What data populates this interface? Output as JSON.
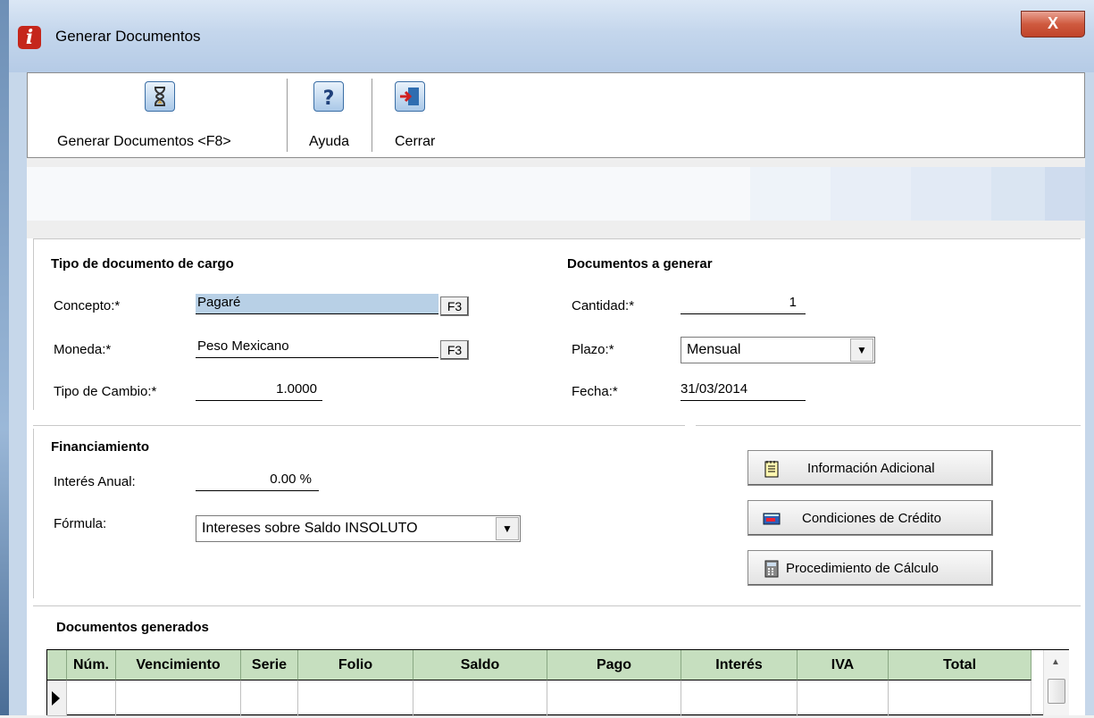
{
  "window": {
    "title": "Generar Documentos",
    "close_label": "X",
    "app_icon": "i"
  },
  "toolbar": {
    "generate_label": "Generar Documentos <F8>",
    "help_label": "Ayuda",
    "close_label": "Cerrar"
  },
  "cargo": {
    "title": "Tipo de documento de cargo",
    "concepto_label": "Concepto:*",
    "concepto_value": "Pagaré",
    "moneda_label": "Moneda:*",
    "moneda_value": "Peso Mexicano",
    "tipo_cambio_label": "Tipo de Cambio:*",
    "tipo_cambio_value": "1.0000",
    "f3": "F3"
  },
  "generar": {
    "title": "Documentos a generar",
    "cantidad_label": "Cantidad:*",
    "cantidad_value": "1",
    "plazo_label": "Plazo:*",
    "plazo_value": "Mensual",
    "fecha_label": "Fecha:*",
    "fecha_value": "31/03/2014"
  },
  "financiamiento": {
    "title": "Financiamiento",
    "interes_label": "Interés Anual:",
    "interes_value": "0.00 %",
    "formula_label": "Fórmula:",
    "formula_value": "Intereses sobre Saldo INSOLUTO"
  },
  "side_buttons": {
    "info": "Información Adicional",
    "condiciones": "Condiciones de Crédito",
    "procedimiento": "Procedimiento de Cálculo"
  },
  "table": {
    "title": "Documentos generados",
    "columns": [
      "Núm.",
      "Vencimiento",
      "Serie",
      "Folio",
      "Saldo",
      "Pago",
      "Interés",
      "IVA",
      "Total"
    ]
  },
  "icons": {
    "generate": "hourglass-icon",
    "help": "question-mark-icon",
    "close": "exit-door-icon",
    "info": "notepad-icon",
    "credit": "credit-card-icon",
    "calc": "calculator-icon"
  },
  "colors": {
    "header_green": "#c6dfbf",
    "title_accent": "#c5261b"
  }
}
